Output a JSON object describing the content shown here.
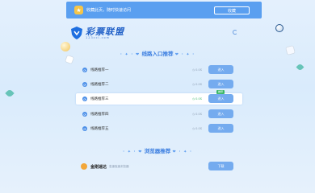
{
  "topbar": {
    "tip": "收藏此页，随时快速访问",
    "save_label": "收藏",
    "icon": "star-icon"
  },
  "logo": {
    "name": "彩票联盟",
    "domain": "123ccl.com"
  },
  "routes_section": {
    "deco_left": "· ✦ · ❤",
    "title": "线路入口推荐",
    "deco_right": "❤ · ✦ ·",
    "rows": [
      {
        "label": "线路推荐一",
        "latency": "◷ 0.0S",
        "button": "进入"
      },
      {
        "label": "线路推荐二",
        "latency": "◷ 0.0S",
        "button": "进入"
      },
      {
        "label": "线路推荐三",
        "latency": "◷ 0.0S",
        "button": "进入",
        "badge": "推荐"
      },
      {
        "label": "线路推荐四",
        "latency": "◷ 0.0S",
        "button": "进入"
      },
      {
        "label": "线路推荐五",
        "latency": "◷ 0.0S",
        "button": "进入"
      }
    ]
  },
  "browser_section": {
    "deco_left": "· ✦ · ❤",
    "title": "浏览器推荐",
    "deco_right": "❤ · ✦ ·",
    "browser": {
      "name": "金刚速达",
      "desc": "急速极速浏览器",
      "button": "下载"
    }
  },
  "colors": {
    "accent": "#5a9ff0",
    "button": "#74abef",
    "brand": "#1f5fc7",
    "success": "#3bb86a"
  }
}
